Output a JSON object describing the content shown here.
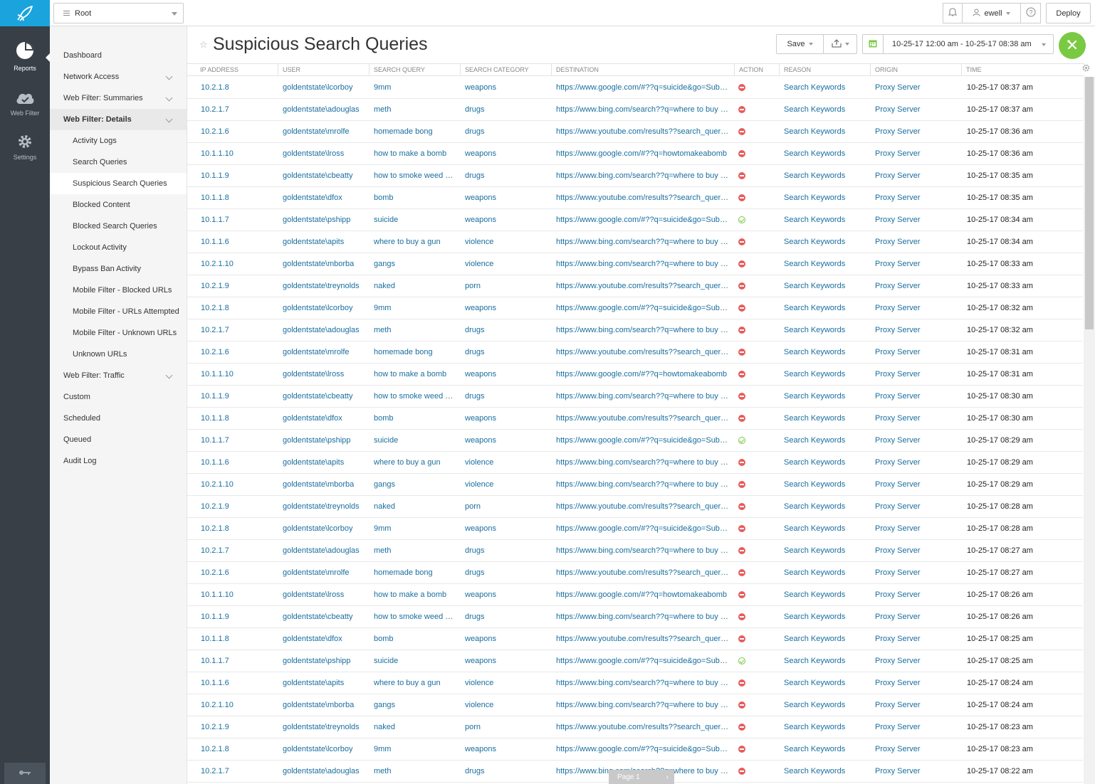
{
  "rail": {
    "items": [
      {
        "label": "Reports",
        "icon": "pie-chart-icon"
      },
      {
        "label": "Web Filter",
        "icon": "cloud-icon"
      },
      {
        "label": "Settings",
        "icon": "gear-icon"
      }
    ]
  },
  "topbar": {
    "root_label": "Root",
    "user_label": "ewell",
    "deploy_label": "Deploy"
  },
  "nav": {
    "items": [
      {
        "label": "Dashboard"
      },
      {
        "label": "Network Access"
      },
      {
        "label": "Web Filter: Summaries"
      },
      {
        "label": "Web Filter: Details"
      },
      {
        "label": "Activity Logs"
      },
      {
        "label": "Search Queries"
      },
      {
        "label": "Suspicious Search Queries"
      },
      {
        "label": "Blocked Content"
      },
      {
        "label": "Blocked Search Queries"
      },
      {
        "label": "Lockout Activity"
      },
      {
        "label": "Bypass Ban Activity"
      },
      {
        "label": "Mobile Filter - Blocked URLs"
      },
      {
        "label": "Mobile Filter - URLs Attempted"
      },
      {
        "label": "Mobile Filter - Unknown URLs"
      },
      {
        "label": "Unknown URLs"
      },
      {
        "label": "Web Filter: Traffic"
      },
      {
        "label": "Custom"
      },
      {
        "label": "Scheduled"
      },
      {
        "label": "Queued"
      },
      {
        "label": "Audit Log"
      }
    ]
  },
  "page": {
    "title": "Suspicious Search Queries",
    "save_label": "Save",
    "date_range": "10-25-17 12:00 am - 10-25-17 08:38 am"
  },
  "table": {
    "columns": [
      "IP ADDRESS",
      "USER",
      "SEARCH QUERY",
      "SEARCH CATEGORY",
      "DESTINATION",
      "ACTION",
      "REASON",
      "ORIGIN",
      "TIME"
    ],
    "rows": [
      {
        "ip": "10.2.1.8",
        "user": "goldentstate\\lcorboy",
        "query": "9mm",
        "category": "weapons",
        "dest": "https://www.google.com/#??q=suicide&go=Submit",
        "action": "blocked",
        "reason": "Search Keywords",
        "origin": "Proxy Server",
        "time": "10-25-17 08:37 am"
      },
      {
        "ip": "10.2.1.7",
        "user": "goldentstate\\adouglas",
        "query": "meth",
        "category": "drugs",
        "dest": "https://www.bing.com/search??q=where to buy meth",
        "action": "blocked",
        "reason": "Search Keywords",
        "origin": "Proxy Server",
        "time": "10-25-17 08:37 am"
      },
      {
        "ip": "10.2.1.6",
        "user": "goldentstate\\mrolfe",
        "query": "homemade bong",
        "category": "drugs",
        "dest": "https://www.youtube.com/results??search_query=bong",
        "action": "blocked",
        "reason": "Search Keywords",
        "origin": "Proxy Server",
        "time": "10-25-17 08:36 am"
      },
      {
        "ip": "10.1.1.10",
        "user": "goldentstate\\lross",
        "query": "how to make a bomb",
        "category": "weapons",
        "dest": "https://www.google.com/#??q=howtomakeabomb",
        "action": "blocked",
        "reason": "Search Keywords",
        "origin": "Proxy Server",
        "time": "10-25-17 08:36 am"
      },
      {
        "ip": "10.1.1.9",
        "user": "goldentstate\\cbeatty",
        "query": "how to smoke weed fast",
        "category": "drugs",
        "dest": "https://www.bing.com/search??q=where to buy weed",
        "action": "blocked",
        "reason": "Search Keywords",
        "origin": "Proxy Server",
        "time": "10-25-17 08:35 am"
      },
      {
        "ip": "10.1.1.8",
        "user": "goldentstate\\dfox",
        "query": "bomb",
        "category": "weapons",
        "dest": "https://www.youtube.com/results??search_query=bomb",
        "action": "blocked",
        "reason": "Search Keywords",
        "origin": "Proxy Server",
        "time": "10-25-17 08:35 am"
      },
      {
        "ip": "10.1.1.7",
        "user": "goldentstate\\pshipp",
        "query": "suicide",
        "category": "weapons",
        "dest": "https://www.google.com/#??q=suicide&go=Submit",
        "action": "allowed",
        "reason": "Search Keywords",
        "origin": "Proxy Server",
        "time": "10-25-17 08:34 am"
      },
      {
        "ip": "10.1.1.6",
        "user": "goldentstate\\apits",
        "query": "where to buy a gun",
        "category": "violence",
        "dest": "https://www.bing.com/search??q=where to buy a gun",
        "action": "blocked",
        "reason": "Search Keywords",
        "origin": "Proxy Server",
        "time": "10-25-17 08:34 am"
      },
      {
        "ip": "10.2.1.10",
        "user": "goldentstate\\mborba",
        "query": "gangs",
        "category": "violence",
        "dest": "https://www.bing.com/search??q=where to buy gangs",
        "action": "blocked",
        "reason": "Search Keywords",
        "origin": "Proxy Server",
        "time": "10-25-17 08:33 am"
      },
      {
        "ip": "10.2.1.9",
        "user": "goldentstate\\treynolds",
        "query": "naked",
        "category": "porn",
        "dest": "https://www.youtube.com/results??search_query=naked",
        "action": "blocked",
        "reason": "Search Keywords",
        "origin": "Proxy Server",
        "time": "10-25-17 08:33 am"
      },
      {
        "ip": "10.2.1.8",
        "user": "goldentstate\\lcorboy",
        "query": "9mm",
        "category": "weapons",
        "dest": "https://www.google.com/#??q=suicide&go=Submit",
        "action": "blocked",
        "reason": "Search Keywords",
        "origin": "Proxy Server",
        "time": "10-25-17 08:32 am"
      },
      {
        "ip": "10.2.1.7",
        "user": "goldentstate\\adouglas",
        "query": "meth",
        "category": "drugs",
        "dest": "https://www.bing.com/search??q=where to buy meth",
        "action": "blocked",
        "reason": "Search Keywords",
        "origin": "Proxy Server",
        "time": "10-25-17 08:32 am"
      },
      {
        "ip": "10.2.1.6",
        "user": "goldentstate\\mrolfe",
        "query": "homemade bong",
        "category": "drugs",
        "dest": "https://www.youtube.com/results??search_query=bong",
        "action": "blocked",
        "reason": "Search Keywords",
        "origin": "Proxy Server",
        "time": "10-25-17 08:31 am"
      },
      {
        "ip": "10.1.1.10",
        "user": "goldentstate\\lross",
        "query": "how to make a bomb",
        "category": "weapons",
        "dest": "https://www.google.com/#??q=howtomakeabomb",
        "action": "blocked",
        "reason": "Search Keywords",
        "origin": "Proxy Server",
        "time": "10-25-17 08:31 am"
      },
      {
        "ip": "10.1.1.9",
        "user": "goldentstate\\cbeatty",
        "query": "how to smoke weed fast",
        "category": "drugs",
        "dest": "https://www.bing.com/search??q=where to buy weed",
        "action": "blocked",
        "reason": "Search Keywords",
        "origin": "Proxy Server",
        "time": "10-25-17 08:30 am"
      },
      {
        "ip": "10.1.1.8",
        "user": "goldentstate\\dfox",
        "query": "bomb",
        "category": "weapons",
        "dest": "https://www.youtube.com/results??search_query=bomb",
        "action": "blocked",
        "reason": "Search Keywords",
        "origin": "Proxy Server",
        "time": "10-25-17 08:30 am"
      },
      {
        "ip": "10.1.1.7",
        "user": "goldentstate\\pshipp",
        "query": "suicide",
        "category": "weapons",
        "dest": "https://www.google.com/#??q=suicide&go=Submit",
        "action": "allowed",
        "reason": "Search Keywords",
        "origin": "Proxy Server",
        "time": "10-25-17 08:29 am"
      },
      {
        "ip": "10.1.1.6",
        "user": "goldentstate\\apits",
        "query": "where to buy a gun",
        "category": "violence",
        "dest": "https://www.bing.com/search??q=where to buy a gun",
        "action": "blocked",
        "reason": "Search Keywords",
        "origin": "Proxy Server",
        "time": "10-25-17 08:29 am"
      },
      {
        "ip": "10.2.1.10",
        "user": "goldentstate\\mborba",
        "query": "gangs",
        "category": "violence",
        "dest": "https://www.bing.com/search??q=where to buy gangs",
        "action": "blocked",
        "reason": "Search Keywords",
        "origin": "Proxy Server",
        "time": "10-25-17 08:29 am"
      },
      {
        "ip": "10.2.1.9",
        "user": "goldentstate\\treynolds",
        "query": "naked",
        "category": "porn",
        "dest": "https://www.youtube.com/results??search_query=naked",
        "action": "blocked",
        "reason": "Search Keywords",
        "origin": "Proxy Server",
        "time": "10-25-17 08:28 am"
      },
      {
        "ip": "10.2.1.8",
        "user": "goldentstate\\lcorboy",
        "query": "9mm",
        "category": "weapons",
        "dest": "https://www.google.com/#??q=suicide&go=Submit",
        "action": "blocked",
        "reason": "Search Keywords",
        "origin": "Proxy Server",
        "time": "10-25-17 08:28 am"
      },
      {
        "ip": "10.2.1.7",
        "user": "goldentstate\\adouglas",
        "query": "meth",
        "category": "drugs",
        "dest": "https://www.bing.com/search??q=where to buy meth",
        "action": "blocked",
        "reason": "Search Keywords",
        "origin": "Proxy Server",
        "time": "10-25-17 08:27 am"
      },
      {
        "ip": "10.2.1.6",
        "user": "goldentstate\\mrolfe",
        "query": "homemade bong",
        "category": "drugs",
        "dest": "https://www.youtube.com/results??search_query=bong",
        "action": "blocked",
        "reason": "Search Keywords",
        "origin": "Proxy Server",
        "time": "10-25-17 08:27 am"
      },
      {
        "ip": "10.1.1.10",
        "user": "goldentstate\\lross",
        "query": "how to make a bomb",
        "category": "weapons",
        "dest": "https://www.google.com/#??q=howtomakeabomb",
        "action": "blocked",
        "reason": "Search Keywords",
        "origin": "Proxy Server",
        "time": "10-25-17 08:26 am"
      },
      {
        "ip": "10.1.1.9",
        "user": "goldentstate\\cbeatty",
        "query": "how to smoke weed fast",
        "category": "drugs",
        "dest": "https://www.bing.com/search??q=where to buy weed",
        "action": "blocked",
        "reason": "Search Keywords",
        "origin": "Proxy Server",
        "time": "10-25-17 08:26 am"
      },
      {
        "ip": "10.1.1.8",
        "user": "goldentstate\\dfox",
        "query": "bomb",
        "category": "weapons",
        "dest": "https://www.youtube.com/results??search_query=bomb",
        "action": "blocked",
        "reason": "Search Keywords",
        "origin": "Proxy Server",
        "time": "10-25-17 08:25 am"
      },
      {
        "ip": "10.1.1.7",
        "user": "goldentstate\\pshipp",
        "query": "suicide",
        "category": "weapons",
        "dest": "https://www.google.com/#??q=suicide&go=Submit",
        "action": "allowed",
        "reason": "Search Keywords",
        "origin": "Proxy Server",
        "time": "10-25-17 08:25 am"
      },
      {
        "ip": "10.1.1.6",
        "user": "goldentstate\\apits",
        "query": "where to buy a gun",
        "category": "violence",
        "dest": "https://www.bing.com/search??q=where to buy a gun",
        "action": "blocked",
        "reason": "Search Keywords",
        "origin": "Proxy Server",
        "time": "10-25-17 08:24 am"
      },
      {
        "ip": "10.2.1.10",
        "user": "goldentstate\\mborba",
        "query": "gangs",
        "category": "violence",
        "dest": "https://www.bing.com/search??q=where to buy gangs",
        "action": "blocked",
        "reason": "Search Keywords",
        "origin": "Proxy Server",
        "time": "10-25-17 08:24 am"
      },
      {
        "ip": "10.2.1.9",
        "user": "goldentstate\\treynolds",
        "query": "naked",
        "category": "porn",
        "dest": "https://www.youtube.com/results??search_query=naked",
        "action": "blocked",
        "reason": "Search Keywords",
        "origin": "Proxy Server",
        "time": "10-25-17 08:23 am"
      },
      {
        "ip": "10.2.1.8",
        "user": "goldentstate\\lcorboy",
        "query": "9mm",
        "category": "weapons",
        "dest": "https://www.google.com/#??q=suicide&go=Submit",
        "action": "blocked",
        "reason": "Search Keywords",
        "origin": "Proxy Server",
        "time": "10-25-17 08:23 am"
      },
      {
        "ip": "10.2.1.7",
        "user": "goldentstate\\adouglas",
        "query": "meth",
        "category": "drugs",
        "dest": "https://www.bing.com/search??q=where to buy meth",
        "action": "blocked",
        "reason": "Search Keywords",
        "origin": "Proxy Server",
        "time": "10-25-17 08:22 am"
      }
    ]
  },
  "pager": {
    "label": "Page 1"
  },
  "colors": {
    "accent": "#1aa3dc",
    "rail": "#383f47",
    "run": "#7ac943",
    "link": "#1a6e9e",
    "block": "#e85c5c"
  }
}
